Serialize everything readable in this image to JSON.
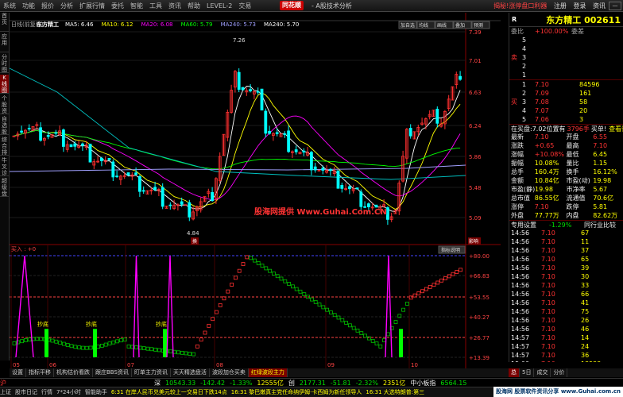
{
  "menu": {
    "items": [
      "系统",
      "功能",
      "报价",
      "分析",
      "扩展行情",
      "委托",
      "智能",
      "工具",
      "资讯",
      "帮助",
      "LEVEL-2",
      "交易"
    ],
    "brand": "同花顺",
    "app_title": "- A股技术分析",
    "links": [
      "揭秘!涨停盘口利器",
      "注册",
      "登录",
      "资讯"
    ],
    "win_btn": "—"
  },
  "left_tabs": [
    {
      "label": "首页"
    },
    {
      "label": "应用"
    },
    {
      "label": "分时图"
    },
    {
      "label": "K线图",
      "active": true
    },
    {
      "label": "个股资料"
    },
    {
      "label": "自选股"
    },
    {
      "label": "综合排名"
    },
    {
      "label": "牛叉诊股"
    },
    {
      "label": "超级盘口"
    }
  ],
  "chart": {
    "period_label": "日线(前复权)",
    "stock_name": "东方精工",
    "ma": [
      {
        "label": "MA5: 6.46",
        "color": "#ffffff"
      },
      {
        "label": "MA10: 6.12",
        "color": "#ffff00"
      },
      {
        "label": "MA20: 6.08",
        "color": "#ff00ff"
      },
      {
        "label": "MA60: 5.79",
        "color": "#00ff00"
      },
      {
        "label": "MA240: 5.73",
        "color": "#a0a0ff"
      },
      {
        "label": "MA240: 5.70",
        "color": "#ffffff"
      }
    ],
    "top_right_buttons": [
      "加自选",
      "均线",
      "画线",
      "叠加",
      "预测"
    ],
    "price_axis": [
      "7.39",
      "7.01",
      "6.63",
      "6.24",
      "5.86",
      "5.48",
      "5.09"
    ],
    "ind_axis": [
      "80.00",
      "66.83",
      "53.55",
      "40.27",
      "26.77",
      "13.39"
    ],
    "x_labels": [
      "05",
      "06",
      "07",
      "08",
      "09",
      "10"
    ],
    "high_label": "7.26",
    "low_label": "4.84",
    "mark1": "换",
    "mark2": "影响",
    "indicator_name": "买入 : +0",
    "indicator_help": "指标说明",
    "signal_label": "抄底",
    "center_watermark": "股海网提供 Www.Guhai.Com.CN"
  },
  "chart_data": {
    "type": "line",
    "x_axis_months": [
      "05",
      "06",
      "07",
      "08",
      "09",
      "10"
    ],
    "ylim": [
      5.09,
      7.39
    ],
    "indicator_ylim": [
      13.39,
      80.0
    ],
    "price_high": 7.26,
    "price_low": 4.84,
    "ma_last": {
      "MA5": 6.46,
      "MA10": 6.12,
      "MA20": 6.08,
      "MA60": 5.79
    }
  },
  "quote": {
    "market": "R",
    "name_code": "东方精工 002611",
    "weibi_label": "委比",
    "weibi": "+100.00%",
    "weicha_label": "委差",
    "sell": [
      {
        "lv": "卖5",
        "p": "",
        "v": ""
      },
      {
        "lv": "卖4",
        "p": "",
        "v": ""
      },
      {
        "lv": "卖3",
        "p": "",
        "v": ""
      },
      {
        "lv": "卖2",
        "p": "",
        "v": ""
      },
      {
        "lv": "卖1",
        "p": "",
        "v": ""
      }
    ],
    "buy": [
      {
        "lv": "买1",
        "p": "7.10",
        "v": "84596"
      },
      {
        "lv": "买2",
        "p": "7.09",
        "v": "161"
      },
      {
        "lv": "买3",
        "p": "7.08",
        "v": "58"
      },
      {
        "lv": "买4",
        "p": "7.07",
        "v": "20"
      },
      {
        "lv": "买5",
        "p": "7.06",
        "v": "3"
      }
    ],
    "buy_label": "买",
    "sell_label": "卖",
    "extra_left": "在买盘:7.02位置有",
    "extra_mid": "3796手",
    "extra_right": "买单!",
    "extra_link": "查看详情",
    "stats": [
      [
        "最新",
        "7.10",
        "开盘",
        "6.55"
      ],
      [
        "涨跌",
        "+0.65",
        "最高",
        "7.10"
      ],
      [
        "涨幅",
        "+10.08%",
        "最低",
        "6.45"
      ],
      [
        "振幅",
        "10.08%",
        "量比",
        "1.15"
      ],
      [
        "总手",
        "160.4万",
        "换手",
        "16.12%"
      ],
      [
        "金额",
        "10.84亿",
        "市盈(动)",
        "19.98"
      ],
      [
        "市盈(静)",
        "19.98",
        "市净率",
        "5.67"
      ],
      [
        "总市值",
        "86.55亿",
        "流通值",
        "70.6亿"
      ],
      [
        "涨停",
        "7.10",
        "跌停",
        "5.81"
      ],
      [
        "外盘",
        "77.77万",
        "内盘",
        "82.62万"
      ]
    ],
    "trade_tab": "专用设置",
    "trade_pct": "-1.29%",
    "trade_link": "同行业比较",
    "ticks": [
      [
        "14:56",
        "7.10",
        "67"
      ],
      [
        "14:56",
        "7.10",
        "11"
      ],
      [
        "14:56",
        "7.10",
        "37"
      ],
      [
        "14:56",
        "7.10",
        "65"
      ],
      [
        "14:56",
        "7.10",
        "39"
      ],
      [
        "14:56",
        "7.10",
        "30"
      ],
      [
        "14:56",
        "7.10",
        "33"
      ],
      [
        "14:56",
        "7.10",
        "66"
      ],
      [
        "14:56",
        "7.10",
        "41"
      ],
      [
        "14:56",
        "7.10",
        "75"
      ],
      [
        "14:56",
        "7.10",
        "26"
      ],
      [
        "14:56",
        "7.10",
        "46"
      ],
      [
        "14:57",
        "7.10",
        "14"
      ],
      [
        "14:57",
        "7.10",
        "24"
      ],
      [
        "14:57",
        "7.10",
        "36"
      ],
      [
        "15:00",
        "7.10",
        "13522"
      ]
    ]
  },
  "bottom_tabs": [
    "设置",
    "指标平移",
    "机构估价看跌",
    "跟庄BBS资讯",
    "盯单主力资讯",
    "天天精选盘活",
    "波段加仓买卖",
    "红绿波段主力"
  ],
  "right_tabs": [
    "总",
    "5日",
    "成交",
    "分价"
  ],
  "quote_strip": {
    "idx": "沪",
    "v1": "深",
    "v2": "10543.33",
    "v3": "-142.42",
    "v4": "-1.33%",
    "v5": "12555亿",
    "v6": "创",
    "v7": "2177.31",
    "v8": "-51.81",
    "v9": "-2.32%",
    "v10": "2351亿",
    "v11": "中小板指",
    "v12": "6564.15"
  },
  "status": {
    "s1": "上证",
    "s2": "股市日记",
    "s3": "行情",
    "s4": "7*24小时",
    "s5": "智能助手",
    "s6": "6:31 在岸人民币兑美元较上一交易日下跌14点",
    "s7": "16:31 黎巴嫩真主党任命纳伊姆·卡西姆为新任领导人",
    "s8": "16:31 大选特朗普:第三",
    "wm": "股海网 股票软件资讯分享 www.Guhai.com.cn"
  }
}
